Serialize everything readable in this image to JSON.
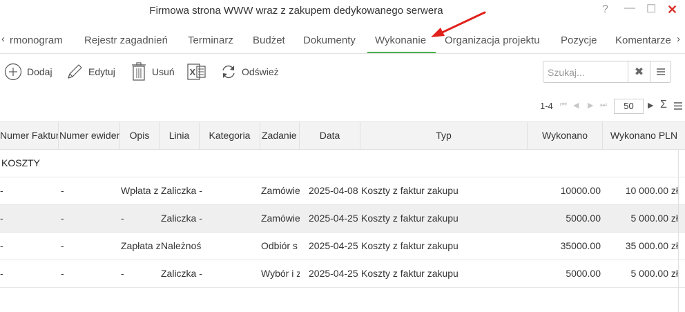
{
  "window": {
    "title": "Firmowa strona WWW wraz z zakupem dedykowanego serwera",
    "help_icon": "?",
    "minimize_icon": "—",
    "maximize_icon": "☐",
    "close_icon": "✕"
  },
  "tabs": {
    "prev_icon": "‹",
    "next_icon": "›",
    "items": [
      {
        "label": "rmonogram"
      },
      {
        "label": "Rejestr zagadnień"
      },
      {
        "label": "Terminarz"
      },
      {
        "label": "Budżet"
      },
      {
        "label": "Dokumenty"
      },
      {
        "label": "Wykonanie"
      },
      {
        "label": "Organizacja projektu"
      },
      {
        "label": "Pozycje"
      },
      {
        "label": "Komentarze"
      }
    ],
    "active": "Wykonanie",
    "accent_color": "#4caf50"
  },
  "annotation": {
    "arrow_color": "#e0211b"
  },
  "toolbar": {
    "add_label": "Dodaj",
    "edit_label": "Edytuj",
    "delete_label": "Usuń",
    "refresh_label": "Odśwież",
    "search_placeholder": "Szukaj...",
    "search_clear_icon": "✖"
  },
  "pager": {
    "range": "1-4",
    "first_icon": "⏮",
    "prev_icon": "◀",
    "next_icon": "▶",
    "last_icon": "⏭",
    "page_size": "50",
    "next_page_icon": "▶",
    "sum_icon": "Σ"
  },
  "grid": {
    "columns": [
      "Numer Faktury",
      "Numer ewidencyjny",
      "Opis",
      "Linia",
      "Kategoria",
      "Zadanie",
      "Data",
      "Typ",
      "Wykonano",
      "Wykonano PLN"
    ],
    "group_label": "KOSZTY",
    "rows": [
      {
        "numer_faktury": "-",
        "numer_ewid": "-",
        "opis": "Wpłata z",
        "linia": "Zaliczka -",
        "kategoria": "",
        "zadanie": "Zamówie",
        "data": "2025-04-08",
        "typ": "Koszty z faktur zakupu",
        "wykonano": "10000.00",
        "wykonano_pln": "10 000.00 zł"
      },
      {
        "numer_faktury": "-",
        "numer_ewid": "-",
        "opis": "-",
        "linia": "Zaliczka -",
        "kategoria": "",
        "zadanie": "Zamówie",
        "data": "2025-04-25",
        "typ": "Koszty z faktur zakupu",
        "wykonano": "5000.00",
        "wykonano_pln": "5 000.00 zł"
      },
      {
        "numer_faktury": "-",
        "numer_ewid": "-",
        "opis": "Zapłata z",
        "linia": "Należnoś",
        "kategoria": "",
        "zadanie": "Odbiór s",
        "data": "2025-04-25",
        "typ": "Koszty z faktur zakupu",
        "wykonano": "35000.00",
        "wykonano_pln": "35 000.00 zł"
      },
      {
        "numer_faktury": "-",
        "numer_ewid": "-",
        "opis": "-",
        "linia": "Zaliczka -",
        "kategoria": "",
        "zadanie": "Wybór i z",
        "data": "2025-04-25",
        "typ": "Koszty z faktur zakupu",
        "wykonano": "5000.00",
        "wykonano_pln": "5 000.00 zł"
      }
    ]
  }
}
